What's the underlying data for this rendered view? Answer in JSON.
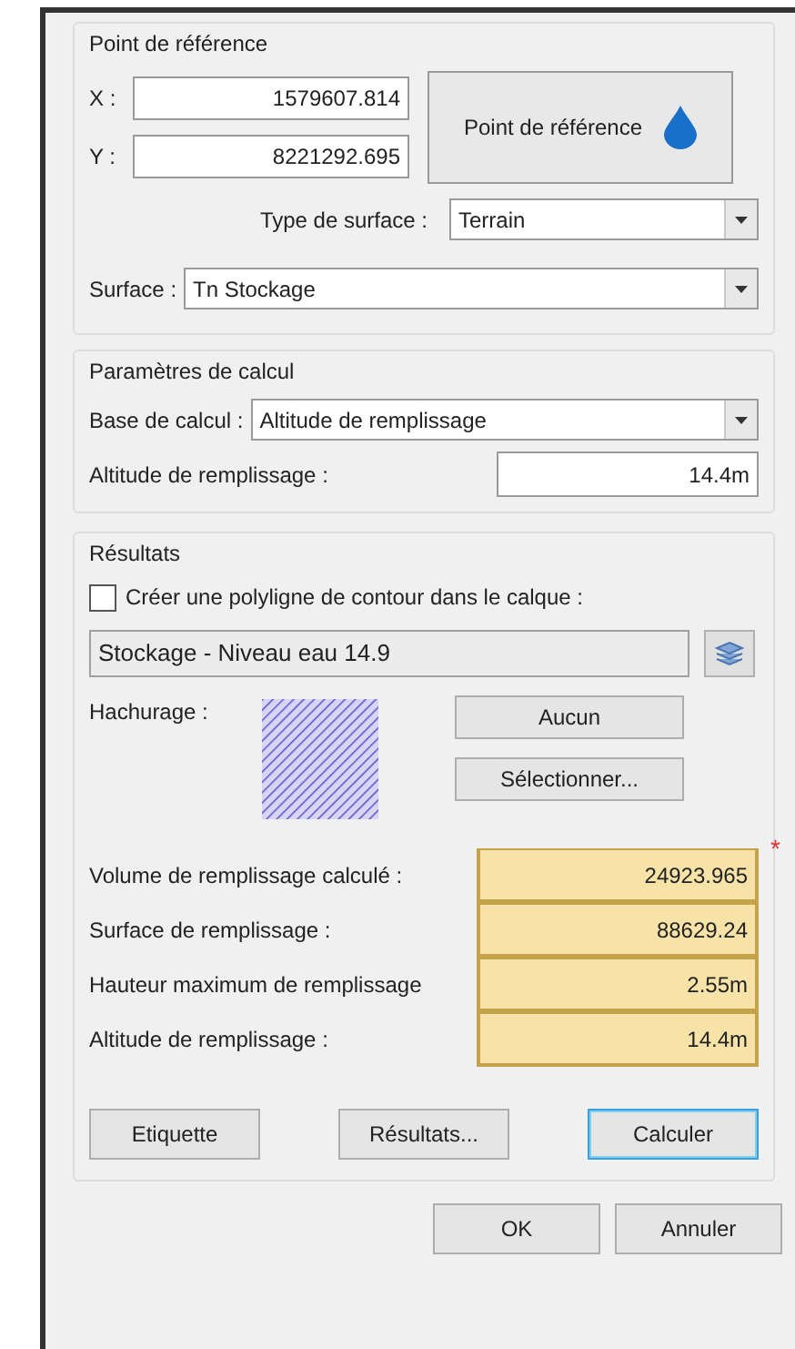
{
  "reference_point": {
    "title": "Point de référence",
    "x_label": "X :",
    "x_value": "1579607.814",
    "y_label": "Y :",
    "y_value": "8221292.695",
    "pick_button": "Point de référence",
    "surface_type_label": "Type de surface :",
    "surface_type_value": "Terrain",
    "surface_label": "Surface :",
    "surface_value": "Tn Stockage"
  },
  "calc_params": {
    "title": "Paramètres de calcul",
    "base_label": "Base de calcul :",
    "base_value": "Altitude de remplissage",
    "altitude_label": "Altitude de remplissage :",
    "altitude_value": "14.4m"
  },
  "results": {
    "title": "Résultats",
    "polyline_label": "Créer une polyligne de contour dans le calque :",
    "polyline_checked": false,
    "layer_value": "Stockage - Niveau eau 14.9",
    "hatch_label": "Hachurage :",
    "hatch_buttons": [
      "Aucun",
      "Sélectionner..."
    ],
    "marker": "*",
    "rows": [
      {
        "label": "Volume de remplissage calculé :",
        "value": "24923.965"
      },
      {
        "label": "Surface de remplissage :",
        "value": "88629.24"
      },
      {
        "label": "Hauteur maximum de remplissage",
        "value": "2.55m"
      },
      {
        "label": "Altitude de remplissage :",
        "value": "14.4m"
      }
    ],
    "buttons": [
      {
        "label": "Etiquette",
        "selected": false
      },
      {
        "label": "Résultats...",
        "selected": false
      },
      {
        "label": "Calculer",
        "selected": true
      }
    ]
  },
  "footer_buttons": [
    "OK",
    "Annuler"
  ]
}
